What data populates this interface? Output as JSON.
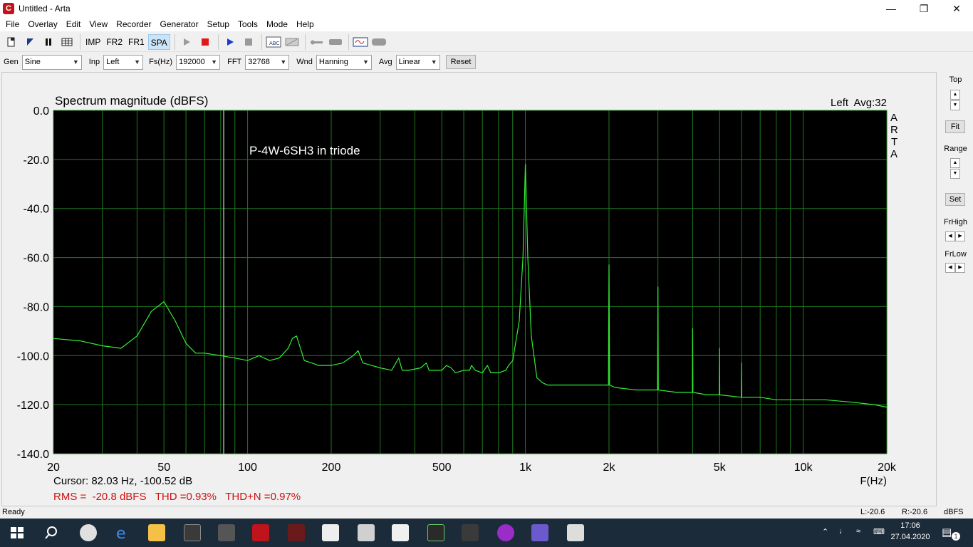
{
  "window": {
    "title": "Untitled - Arta",
    "app_icon_letter": "C"
  },
  "menu": [
    "File",
    "Overlay",
    "Edit",
    "View",
    "Recorder",
    "Generator",
    "Setup",
    "Tools",
    "Mode",
    "Help"
  ],
  "toolbar": {
    "imp": "IMP",
    "fr2": "FR2",
    "fr1": "FR1",
    "spa": "SPA"
  },
  "controls": {
    "gen_label": "Gen",
    "gen_value": "Sine",
    "inp_label": "Inp",
    "inp_value": "Left",
    "fs_label": "Fs(Hz)",
    "fs_value": "192000",
    "fft_label": "FFT",
    "fft_value": "32768",
    "wnd_label": "Wnd",
    "wnd_value": "Hanning",
    "avg_label": "Avg",
    "avg_value": "Linear",
    "reset_label": "Reset"
  },
  "plot": {
    "title": "Spectrum magnitude (dBFS)",
    "channel_info": "Left  Avg:32",
    "annotation": "P-4W-6SH3 in triode",
    "arta_logo": [
      "A",
      "R",
      "T",
      "A"
    ],
    "cursor_text": "Cursor: 82.03 Hz, -100.52 dB",
    "measurements": "RMS =  -20.8 dBFS   THD =0.93%   THD+N =0.97%",
    "xlabel": "F(Hz)"
  },
  "chart_data": {
    "type": "line",
    "title": "Spectrum magnitude (dBFS)",
    "xlabel": "F(Hz)",
    "ylabel": "",
    "x_scale": "log",
    "xlim": [
      20,
      20000
    ],
    "ylim": [
      -140,
      0
    ],
    "x_ticks": [
      20,
      50,
      100,
      200,
      500,
      1000,
      2000,
      5000,
      10000,
      20000
    ],
    "x_tick_labels": [
      "20",
      "50",
      "100",
      "200",
      "500",
      "1k",
      "2k",
      "5k",
      "10k",
      "20k"
    ],
    "y_ticks": [
      0,
      -20,
      -40,
      -60,
      -80,
      -100,
      -120,
      -140
    ],
    "y_tick_labels": [
      "0.0",
      "-20.0",
      "-40.0",
      "-60.0",
      "-80.0",
      "-100.0",
      "-120.0",
      "-140.0"
    ],
    "cursor_hz": 82.03,
    "grid": true,
    "series": [
      {
        "color": "#33ee33",
        "x": [
          20,
          25,
          30,
          35,
          40,
          45,
          50,
          55,
          60,
          65,
          70,
          80,
          90,
          100,
          110,
          120,
          130,
          140,
          145,
          150,
          155,
          160,
          170,
          180,
          200,
          220,
          240,
          250,
          260,
          280,
          300,
          330,
          350,
          360,
          380,
          420,
          440,
          450,
          460,
          500,
          520,
          540,
          560,
          600,
          630,
          640,
          660,
          700,
          730,
          750,
          800,
          850,
          870,
          900,
          950,
          980,
          1000,
          1020,
          1050,
          1100,
          1150,
          1200,
          1300,
          1500,
          1700,
          1900,
          1990,
          2000,
          2010,
          2100,
          2500,
          2990,
          3000,
          3010,
          3500,
          3990,
          4000,
          4010,
          4500,
          4990,
          5000,
          5010,
          5990,
          6000,
          6010,
          7000,
          8000,
          10000,
          12000,
          15000,
          18000,
          20000
        ],
        "y": [
          -93,
          -94,
          -96,
          -97,
          -92,
          -82,
          -78,
          -86,
          -95,
          -99,
          -99,
          -100,
          -101,
          -102,
          -100,
          -102,
          -101,
          -97,
          -93,
          -92,
          -97,
          -102,
          -103,
          -104,
          -104,
          -103,
          -100,
          -98,
          -103,
          -104,
          -105,
          -106,
          -101,
          -106,
          -106,
          -105,
          -103,
          -106,
          -106,
          -106,
          -104,
          -105,
          -107,
          -106,
          -106,
          -104,
          -106,
          -107,
          -104,
          -107,
          -107,
          -106,
          -104,
          -102,
          -86,
          -60,
          -22,
          -60,
          -92,
          -109,
          -111,
          -112,
          -112,
          -112,
          -112,
          -112,
          -112,
          -63,
          -112,
          -113,
          -114,
          -114,
          -72,
          -114,
          -115,
          -115,
          -89,
          -115,
          -116,
          -116,
          -97,
          -116,
          -117,
          -103,
          -117,
          -117,
          -118,
          -118,
          -118,
          -119,
          -120,
          -121
        ]
      }
    ]
  },
  "side_panel": {
    "top_label": "Top",
    "fit_label": "Fit",
    "range_label": "Range",
    "set_label": "Set",
    "frhigh_label": "FrHigh",
    "frlow_label": "FrLow"
  },
  "status": {
    "ready": "Ready",
    "l_value": "L:-20.6",
    "r_value": "R:-20.6",
    "unit": "dBFS"
  },
  "taskbar": {
    "time": "17:06",
    "date": "27.04.2020",
    "notification_count": "1"
  }
}
